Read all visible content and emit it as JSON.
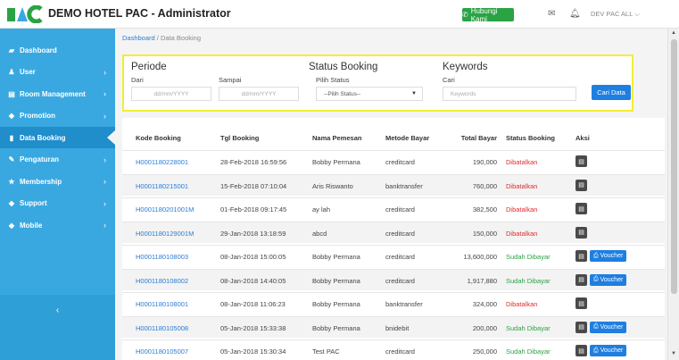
{
  "header": {
    "app_title": "DEMO HOTEL PAC - Administrator",
    "contact_label": "Hubungi Kami",
    "user_label": "DEV PAC ALL ⌵"
  },
  "colors": {
    "sidebar": "#3aa8e0",
    "accent": "#1e7fe0",
    "success": "#2aa344",
    "danger": "#e02b2b"
  },
  "sidebar": {
    "items": [
      {
        "label": "Dashboard",
        "icon": "dashboard-icon",
        "has_children": false,
        "active": false
      },
      {
        "label": "User",
        "icon": "user-icon",
        "has_children": true,
        "active": false
      },
      {
        "label": "Room Management",
        "icon": "room-icon",
        "has_children": true,
        "active": false
      },
      {
        "label": "Promotion",
        "icon": "tag-icon",
        "has_children": true,
        "active": false
      },
      {
        "label": "Data Booking",
        "icon": "book-icon",
        "has_children": false,
        "active": true
      },
      {
        "label": "Pengaturan",
        "icon": "wrench-icon",
        "has_children": true,
        "active": false
      },
      {
        "label": "Membership",
        "icon": "star-icon",
        "has_children": true,
        "active": false
      },
      {
        "label": "Support",
        "icon": "tag-icon",
        "has_children": true,
        "active": false
      },
      {
        "label": "Mobile",
        "icon": "tag-icon",
        "has_children": true,
        "active": false
      }
    ],
    "collapse_label": "‹"
  },
  "breadcrumb": {
    "home": "Dashboard",
    "separator": "/",
    "current": "Data Booking"
  },
  "filter": {
    "periode": "Periode",
    "dari_label": "Dari",
    "dari_placeholder": "dd/mm/YYYY",
    "sampai_label": "Sampai",
    "sampai_placeholder": "dd/mm/YYYY",
    "status_heading": "Status Booking",
    "status_label": "Pilih Status",
    "status_value": "--Pilih Status--",
    "keywords_heading": "Keywords",
    "cari_label": "Cari",
    "keywords_placeholder": "Keywords",
    "search_button": "Cari Data"
  },
  "table": {
    "columns": [
      "Kode Booking",
      "Tgl Booking",
      "Nama Pemesan",
      "Metode Bayar",
      "Total Bayar",
      "Status Booking",
      "Aksi"
    ],
    "voucher_label": "Voucher",
    "rows": [
      {
        "code": "H0001180228001",
        "date": "28-Feb-2018 16:59:56",
        "name": "Bobby Permana",
        "method": "creditcard",
        "total": "190,000",
        "status": "Dibatalkan",
        "paid": false
      },
      {
        "code": "H0001180215001",
        "date": "15-Feb-2018 07:10:04",
        "name": "Aris Riswanto",
        "method": "banktransfer",
        "total": "760,000",
        "status": "Dibatalkan",
        "paid": false
      },
      {
        "code": "H0001180201001M",
        "date": "01-Feb-2018 09:17:45",
        "name": "ay lah",
        "method": "creditcard",
        "total": "382,500",
        "status": "Dibatalkan",
        "paid": false
      },
      {
        "code": "H0001180129001M",
        "date": "29-Jan-2018 13:18:59",
        "name": "abcd",
        "method": "creditcard",
        "total": "150,000",
        "status": "Dibatalkan",
        "paid": false
      },
      {
        "code": "H0001180108003",
        "date": "08-Jan-2018 15:00:05",
        "name": "Bobby Permana",
        "method": "creditcard",
        "total": "13,600,000",
        "status": "Sudah Dibayar",
        "paid": true
      },
      {
        "code": "H0001180108002",
        "date": "08-Jan-2018 14:40:05",
        "name": "Bobby Permana",
        "method": "creditcard",
        "total": "1,917,880",
        "status": "Sudah Dibayar",
        "paid": true
      },
      {
        "code": "H0001180108001",
        "date": "08-Jan-2018 11:06:23",
        "name": "Bobby Permana",
        "method": "banktransfer",
        "total": "324,000",
        "status": "Dibatalkan",
        "paid": false
      },
      {
        "code": "H0001180105008",
        "date": "05-Jan-2018 15:33:38",
        "name": "Bobby Permana",
        "method": "bnidebit",
        "total": "200,000",
        "status": "Sudah Dibayar",
        "paid": true
      },
      {
        "code": "H0001180105007",
        "date": "05-Jan-2018 15:30:34",
        "name": "Test PAC",
        "method": "creditcard",
        "total": "250,000",
        "status": "Sudah Dibayar",
        "paid": true
      }
    ]
  }
}
